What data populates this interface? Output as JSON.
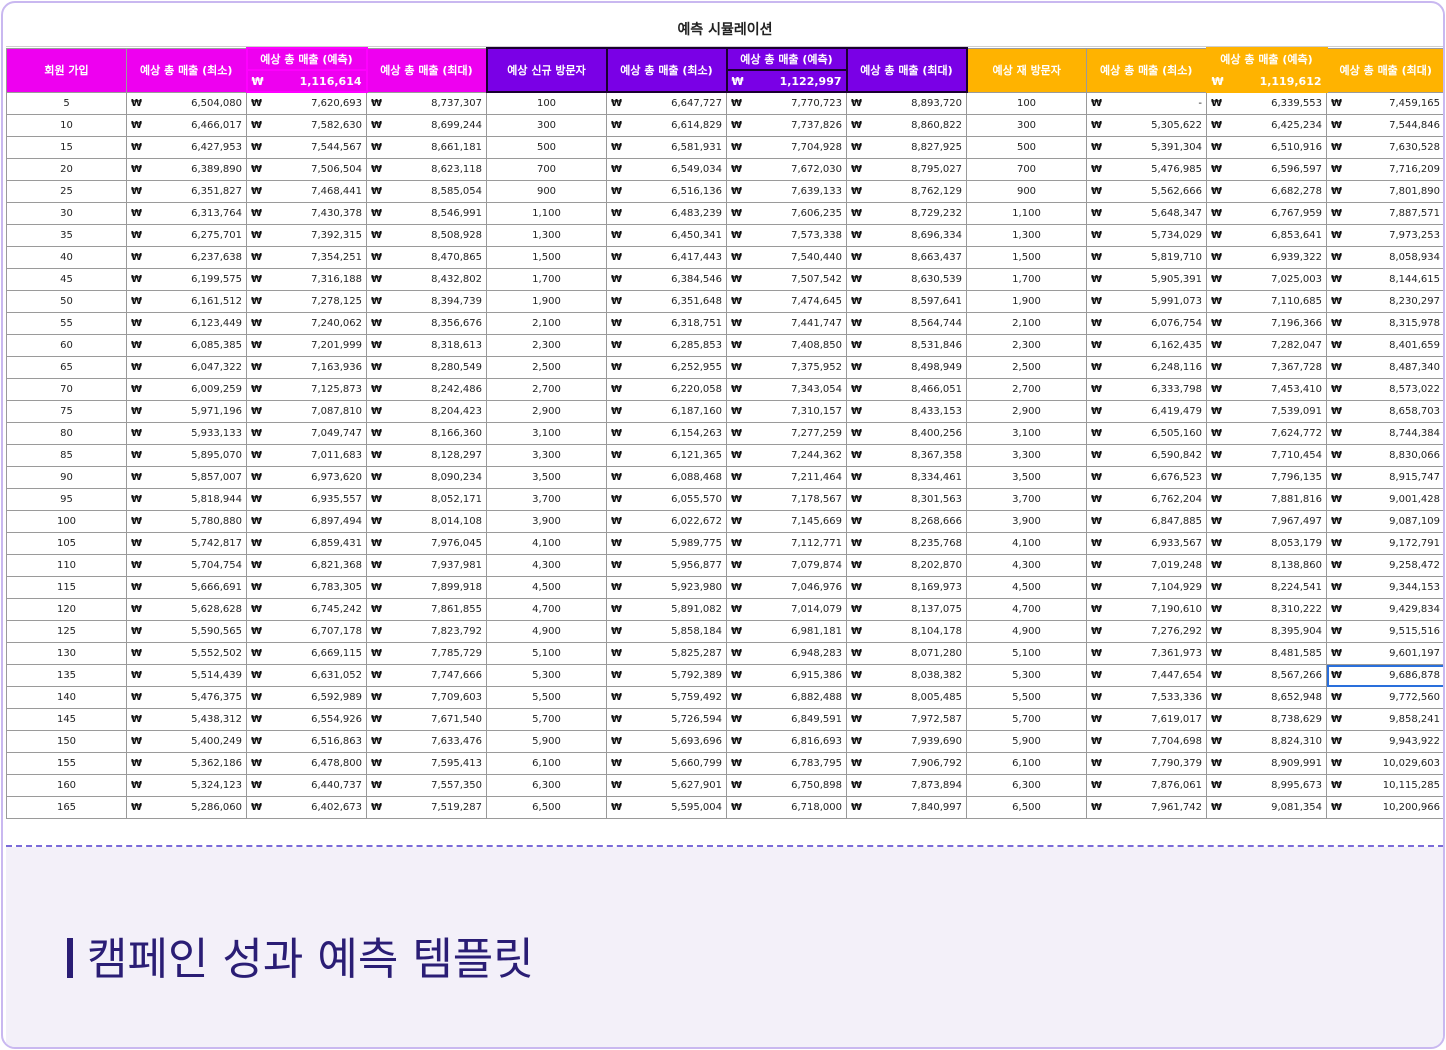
{
  "sheet": {
    "title": "예측 시뮬레이션",
    "currency_symbol": "₩",
    "headers": {
      "signup": "회원 가입",
      "pink_min": "예상 총 매출 (최소)",
      "pink_pred": "예상 총 매출 (예측)",
      "pink_pred_value": "1,116,614",
      "pink_max": "예상 총 매출 (최대)",
      "new_visitors": "예상 신규 방문자",
      "purple_min": "예상 총 매출 (최소)",
      "purple_pred": "예상 총 매출 (예측)",
      "purple_pred_value": "1,122,997",
      "purple_max": "예상 총 매출 (최대)",
      "return_visitors": "예상 재 방문자",
      "orange_min": "예상 총 매출 (최소)",
      "orange_pred": "예상 총 매출 (예측)",
      "orange_pred_value": "1,119,612",
      "orange_max": "예상 총 매출 (최대)"
    },
    "colors": {
      "pink": "#ee00f0",
      "purple": "#7a00e6",
      "orange": "#ffb300"
    },
    "rows": [
      [
        "5",
        "6,504,080",
        "7,620,693",
        "8,737,307",
        "100",
        "6,647,727",
        "7,770,723",
        "8,893,720",
        "100",
        "-",
        "6,339,553",
        "7,459,165"
      ],
      [
        "10",
        "6,466,017",
        "7,582,630",
        "8,699,244",
        "300",
        "6,614,829",
        "7,737,826",
        "8,860,822",
        "300",
        "5,305,622",
        "6,425,234",
        "7,544,846"
      ],
      [
        "15",
        "6,427,953",
        "7,544,567",
        "8,661,181",
        "500",
        "6,581,931",
        "7,704,928",
        "8,827,925",
        "500",
        "5,391,304",
        "6,510,916",
        "7,630,528"
      ],
      [
        "20",
        "6,389,890",
        "7,506,504",
        "8,623,118",
        "700",
        "6,549,034",
        "7,672,030",
        "8,795,027",
        "700",
        "5,476,985",
        "6,596,597",
        "7,716,209"
      ],
      [
        "25",
        "6,351,827",
        "7,468,441",
        "8,585,054",
        "900",
        "6,516,136",
        "7,639,133",
        "8,762,129",
        "900",
        "5,562,666",
        "6,682,278",
        "7,801,890"
      ],
      [
        "30",
        "6,313,764",
        "7,430,378",
        "8,546,991",
        "1,100",
        "6,483,239",
        "7,606,235",
        "8,729,232",
        "1,100",
        "5,648,347",
        "6,767,959",
        "7,887,571"
      ],
      [
        "35",
        "6,275,701",
        "7,392,315",
        "8,508,928",
        "1,300",
        "6,450,341",
        "7,573,338",
        "8,696,334",
        "1,300",
        "5,734,029",
        "6,853,641",
        "7,973,253"
      ],
      [
        "40",
        "6,237,638",
        "7,354,251",
        "8,470,865",
        "1,500",
        "6,417,443",
        "7,540,440",
        "8,663,437",
        "1,500",
        "5,819,710",
        "6,939,322",
        "8,058,934"
      ],
      [
        "45",
        "6,199,575",
        "7,316,188",
        "8,432,802",
        "1,700",
        "6,384,546",
        "7,507,542",
        "8,630,539",
        "1,700",
        "5,905,391",
        "7,025,003",
        "8,144,615"
      ],
      [
        "50",
        "6,161,512",
        "7,278,125",
        "8,394,739",
        "1,900",
        "6,351,648",
        "7,474,645",
        "8,597,641",
        "1,900",
        "5,991,073",
        "7,110,685",
        "8,230,297"
      ],
      [
        "55",
        "6,123,449",
        "7,240,062",
        "8,356,676",
        "2,100",
        "6,318,751",
        "7,441,747",
        "8,564,744",
        "2,100",
        "6,076,754",
        "7,196,366",
        "8,315,978"
      ],
      [
        "60",
        "6,085,385",
        "7,201,999",
        "8,318,613",
        "2,300",
        "6,285,853",
        "7,408,850",
        "8,531,846",
        "2,300",
        "6,162,435",
        "7,282,047",
        "8,401,659"
      ],
      [
        "65",
        "6,047,322",
        "7,163,936",
        "8,280,549",
        "2,500",
        "6,252,955",
        "7,375,952",
        "8,498,949",
        "2,500",
        "6,248,116",
        "7,367,728",
        "8,487,340"
      ],
      [
        "70",
        "6,009,259",
        "7,125,873",
        "8,242,486",
        "2,700",
        "6,220,058",
        "7,343,054",
        "8,466,051",
        "2,700",
        "6,333,798",
        "7,453,410",
        "8,573,022"
      ],
      [
        "75",
        "5,971,196",
        "7,087,810",
        "8,204,423",
        "2,900",
        "6,187,160",
        "7,310,157",
        "8,433,153",
        "2,900",
        "6,419,479",
        "7,539,091",
        "8,658,703"
      ],
      [
        "80",
        "5,933,133",
        "7,049,747",
        "8,166,360",
        "3,100",
        "6,154,263",
        "7,277,259",
        "8,400,256",
        "3,100",
        "6,505,160",
        "7,624,772",
        "8,744,384"
      ],
      [
        "85",
        "5,895,070",
        "7,011,683",
        "8,128,297",
        "3,300",
        "6,121,365",
        "7,244,362",
        "8,367,358",
        "3,300",
        "6,590,842",
        "7,710,454",
        "8,830,066"
      ],
      [
        "90",
        "5,857,007",
        "6,973,620",
        "8,090,234",
        "3,500",
        "6,088,468",
        "7,211,464",
        "8,334,461",
        "3,500",
        "6,676,523",
        "7,796,135",
        "8,915,747"
      ],
      [
        "95",
        "5,818,944",
        "6,935,557",
        "8,052,171",
        "3,700",
        "6,055,570",
        "7,178,567",
        "8,301,563",
        "3,700",
        "6,762,204",
        "7,881,816",
        "9,001,428"
      ],
      [
        "100",
        "5,780,880",
        "6,897,494",
        "8,014,108",
        "3,900",
        "6,022,672",
        "7,145,669",
        "8,268,666",
        "3,900",
        "6,847,885",
        "7,967,497",
        "9,087,109"
      ],
      [
        "105",
        "5,742,817",
        "6,859,431",
        "7,976,045",
        "4,100",
        "5,989,775",
        "7,112,771",
        "8,235,768",
        "4,100",
        "6,933,567",
        "8,053,179",
        "9,172,791"
      ],
      [
        "110",
        "5,704,754",
        "6,821,368",
        "7,937,981",
        "4,300",
        "5,956,877",
        "7,079,874",
        "8,202,870",
        "4,300",
        "7,019,248",
        "8,138,860",
        "9,258,472"
      ],
      [
        "115",
        "5,666,691",
        "6,783,305",
        "7,899,918",
        "4,500",
        "5,923,980",
        "7,046,976",
        "8,169,973",
        "4,500",
        "7,104,929",
        "8,224,541",
        "9,344,153"
      ],
      [
        "120",
        "5,628,628",
        "6,745,242",
        "7,861,855",
        "4,700",
        "5,891,082",
        "7,014,079",
        "8,137,075",
        "4,700",
        "7,190,610",
        "8,310,222",
        "9,429,834"
      ],
      [
        "125",
        "5,590,565",
        "6,707,178",
        "7,823,792",
        "4,900",
        "5,858,184",
        "6,981,181",
        "8,104,178",
        "4,900",
        "7,276,292",
        "8,395,904",
        "9,515,516"
      ],
      [
        "130",
        "5,552,502",
        "6,669,115",
        "7,785,729",
        "5,100",
        "5,825,287",
        "6,948,283",
        "8,071,280",
        "5,100",
        "7,361,973",
        "8,481,585",
        "9,601,197"
      ],
      [
        "135",
        "5,514,439",
        "6,631,052",
        "7,747,666",
        "5,300",
        "5,792,389",
        "6,915,386",
        "8,038,382",
        "5,300",
        "7,447,654",
        "8,567,266",
        "9,686,878"
      ],
      [
        "140",
        "5,476,375",
        "6,592,989",
        "7,709,603",
        "5,500",
        "5,759,492",
        "6,882,488",
        "8,005,485",
        "5,500",
        "7,533,336",
        "8,652,948",
        "9,772,560"
      ],
      [
        "145",
        "5,438,312",
        "6,554,926",
        "7,671,540",
        "5,700",
        "5,726,594",
        "6,849,591",
        "7,972,587",
        "5,700",
        "7,619,017",
        "8,738,629",
        "9,858,241"
      ],
      [
        "150",
        "5,400,249",
        "6,516,863",
        "7,633,476",
        "5,900",
        "5,693,696",
        "6,816,693",
        "7,939,690",
        "5,900",
        "7,704,698",
        "8,824,310",
        "9,943,922"
      ],
      [
        "155",
        "5,362,186",
        "6,478,800",
        "7,595,413",
        "6,100",
        "5,660,799",
        "6,783,795",
        "7,906,792",
        "6,100",
        "7,790,379",
        "8,909,991",
        "10,029,603"
      ],
      [
        "160",
        "5,324,123",
        "6,440,737",
        "7,557,350",
        "6,300",
        "5,627,901",
        "6,750,898",
        "7,873,894",
        "6,300",
        "7,876,061",
        "8,995,673",
        "10,115,285"
      ],
      [
        "165",
        "5,286,060",
        "6,402,673",
        "7,519,287",
        "6,500",
        "5,595,004",
        "6,718,000",
        "7,840,997",
        "6,500",
        "7,961,742",
        "9,081,354",
        "10,200,966"
      ]
    ]
  },
  "caption": "캠페인 성과 예측 템플릿"
}
